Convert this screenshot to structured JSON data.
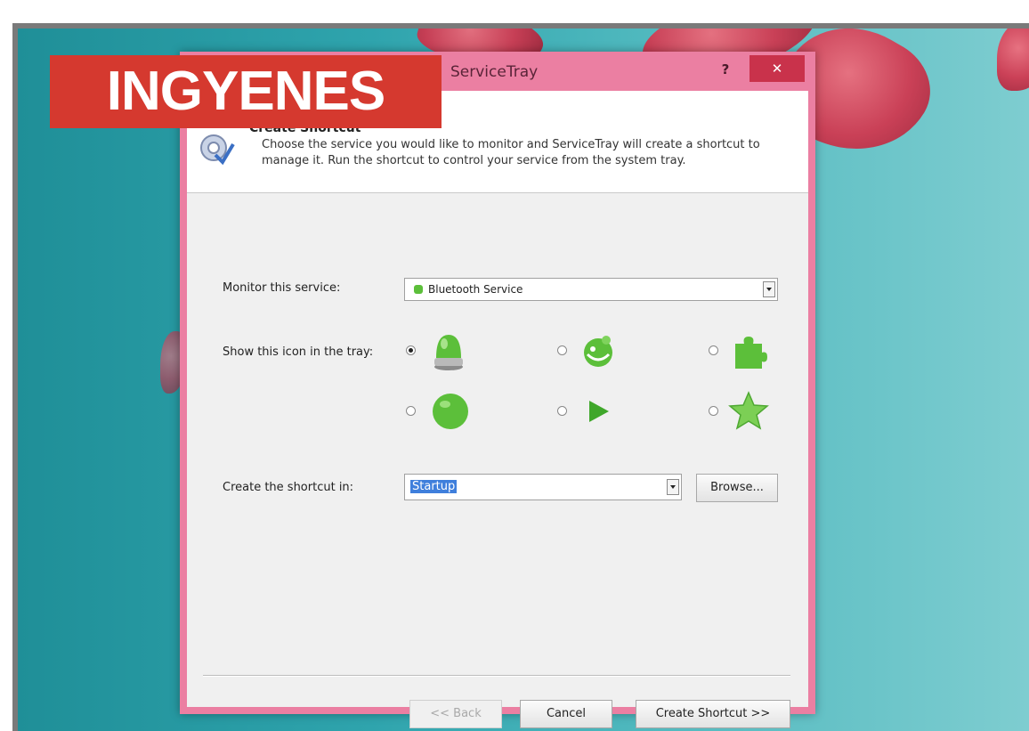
{
  "badge": {
    "text": "INGYENES"
  },
  "window": {
    "title": "ServiceTray",
    "help_label": "?",
    "close_label": "✕"
  },
  "header": {
    "title": "Create Shortcut",
    "description": "Choose the service you would like to monitor and ServiceTray will create a shortcut to manage it. Run the shortcut to control your service from the system tray."
  },
  "form": {
    "service_label": "Monitor this service:",
    "service_value": "Bluetooth Service",
    "icon_label": "Show this icon in the tray:",
    "icon_options": [
      "green-light-icon",
      "green-smiley-icon",
      "green-puzzle-icon",
      "green-circle-icon",
      "green-play-icon",
      "green-star-icon"
    ],
    "icon_selected": "green-light-icon",
    "location_label": "Create the shortcut in:",
    "location_value": "Startup",
    "browse_label": "Browse..."
  },
  "footer": {
    "back_label": "<< Back",
    "cancel_label": "Cancel",
    "create_label": "Create Shortcut >>"
  },
  "colors": {
    "window_border": "#eb7fa2",
    "close_button": "#c9324b",
    "badge": "#d5392f",
    "icon_green": "#5cbf3a"
  }
}
